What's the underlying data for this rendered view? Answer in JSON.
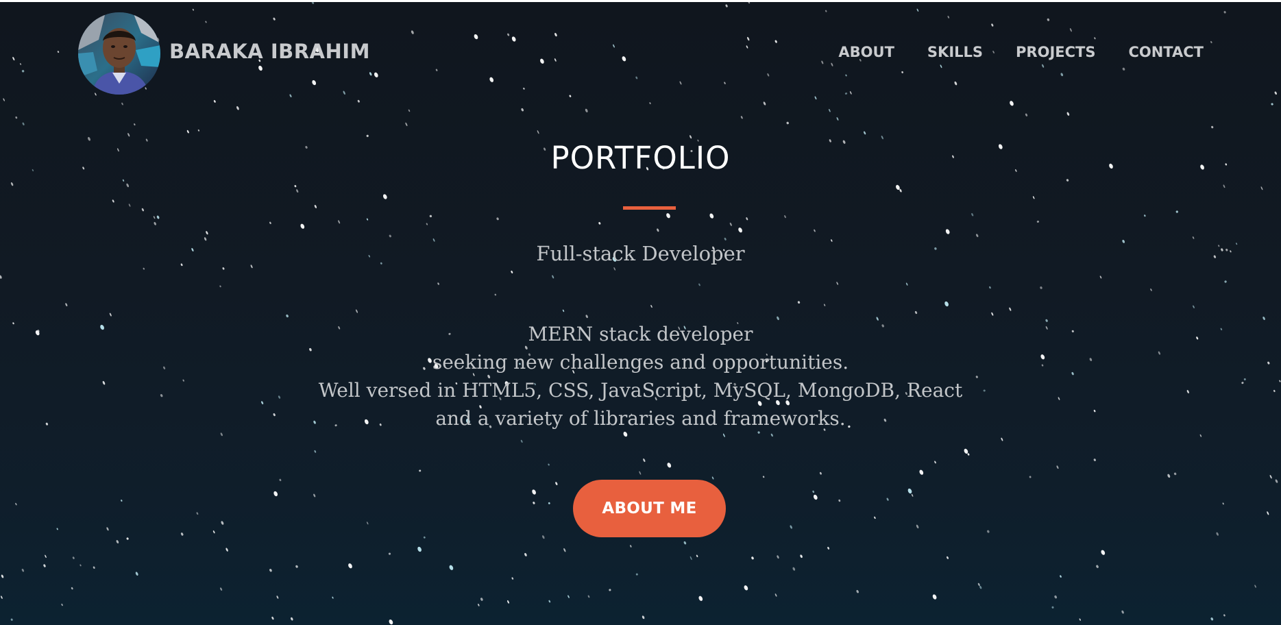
{
  "header": {
    "brand_name": "BARAKA IBRAHIM",
    "nav": [
      {
        "label": "ABOUT"
      },
      {
        "label": "SKILLS"
      },
      {
        "label": "PROJECTS"
      },
      {
        "label": "CONTACT"
      }
    ]
  },
  "hero": {
    "title": "PORTFOLIO",
    "subtitle": "Full-stack Developer",
    "bio_lines": [
      "MERN stack developer",
      "seeking new challenges and opportunities.",
      "Well versed in HTML5, CSS, JavaScript, MySQL, MongoDB, React",
      "and a variety of libraries and frameworks."
    ],
    "cta_label": "ABOUT ME"
  },
  "theme": {
    "accent": "#e8603e",
    "background_top": "#10161e",
    "background_bottom": "#0c2231",
    "nav_text": "#c9cbce",
    "body_text": "#c3c6c9"
  }
}
